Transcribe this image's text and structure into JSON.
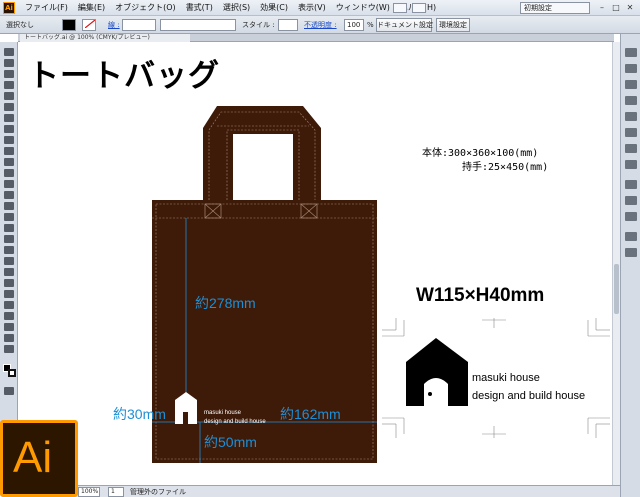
{
  "menubar": {
    "app_icon": "Ai",
    "items": [
      "ファイル(F)",
      "編集(E)",
      "オブジェクト(O)",
      "書式(T)",
      "選択(S)",
      "効果(C)",
      "表示(V)",
      "ウィンドウ(W)",
      "ヘルプ(H)"
    ],
    "workspace": "初期設定",
    "window_buttons": [
      "–",
      "□",
      "✕"
    ]
  },
  "controlbar": {
    "selection": "選択なし",
    "stroke_label": "線 :",
    "style_label": "スタイル :",
    "opacity_label": "不透明度 :",
    "opacity_value": "100",
    "opacity_unit": "%",
    "doc_settings": "ドキュメント設定",
    "preferences": "環境設定"
  },
  "document_tab": "トートバッグ.ai @ 100% (CMYK/プレビュー)",
  "artwork": {
    "title": "トートバッグ",
    "spec_body": "本体:300×360×100(mm)",
    "spec_handle": "持手:25×450(mm)",
    "dim_height": "約278mm",
    "dim_left": "約30mm",
    "dim_right": "約162mm",
    "dim_bottom": "約50mm",
    "size_label": "W115×H40mm",
    "logo_line1": "masuki house",
    "logo_line2": "design and build house"
  },
  "statusbar": {
    "zoom": "100%",
    "page": "1",
    "status": "管理外のファイル"
  },
  "badge": {
    "text": "Ai"
  },
  "colors": {
    "bag": "#3e1a08",
    "dimension": "#1e8fd6",
    "accent_orange": "#ff9a00"
  }
}
